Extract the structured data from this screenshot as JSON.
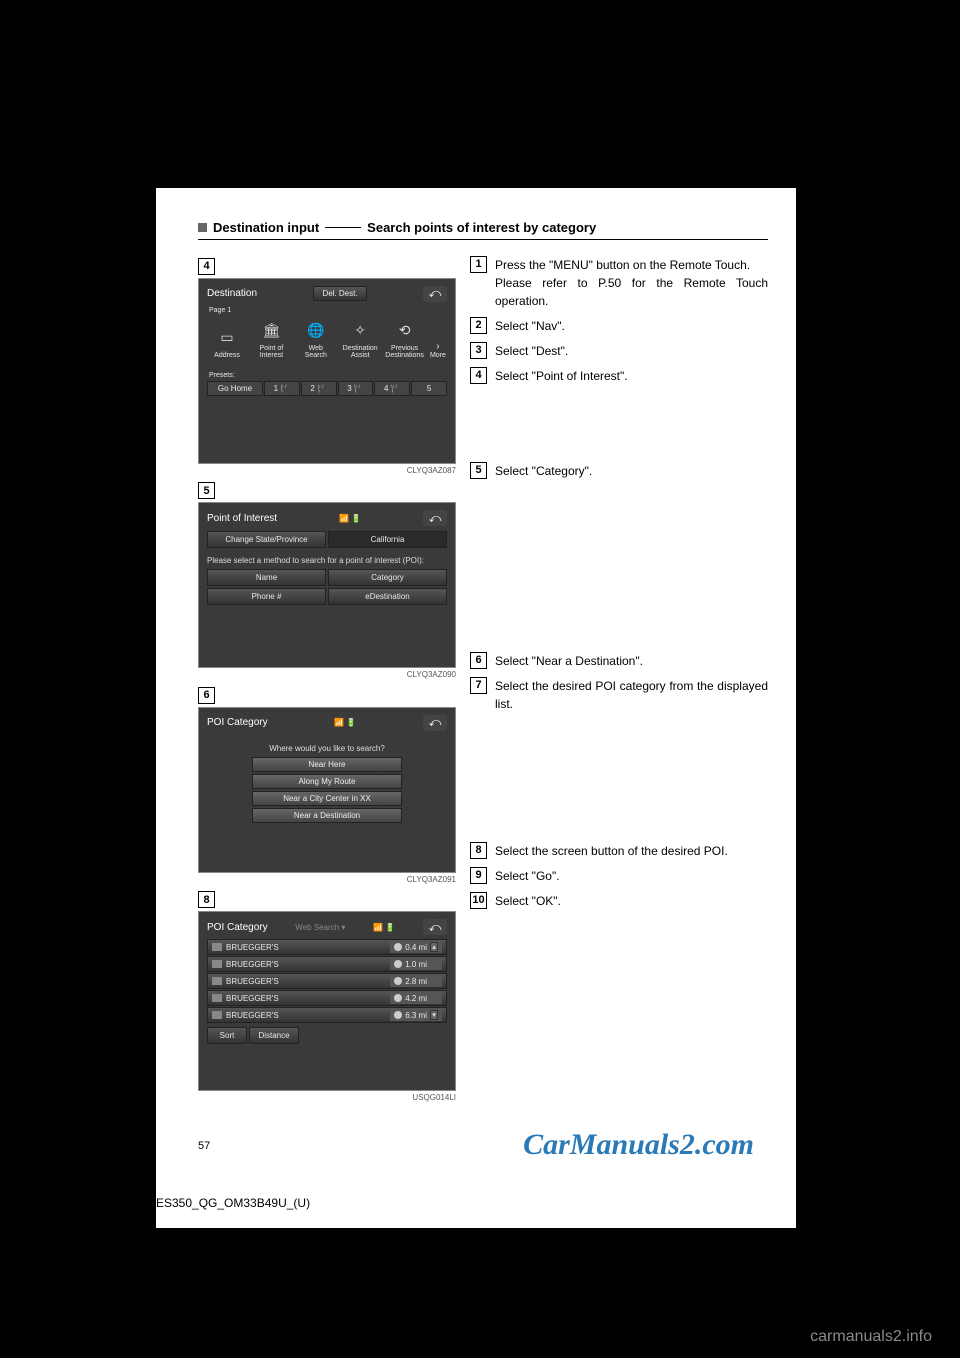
{
  "header": {
    "prefix": "Destination input",
    "title": "Search points of interest by category"
  },
  "screens": {
    "s4": {
      "badge": "4",
      "title": "Destination",
      "del": "Del. Dest.",
      "page": "Page 1",
      "icons": [
        "Address",
        "Point of\nInterest",
        "Web\nSearch",
        "Destination\nAssist",
        "Previous\nDestinations",
        "More"
      ],
      "presets_label": "Presets:",
      "presets": [
        "Go Home",
        "1",
        "2",
        "3",
        "4",
        "5"
      ],
      "ref": "CLYQ3AZ087"
    },
    "s5": {
      "badge": "5",
      "title": "Point of Interest",
      "state_btn": "Change State/Province",
      "state_val": "California",
      "msg": "Please select a method to search for a point of interest (POI):",
      "opts": [
        "Name",
        "Category",
        "Phone #",
        "eDestination"
      ],
      "ref": "CLYQ3AZ090"
    },
    "s6": {
      "badge": "6",
      "title": "POI Category",
      "msg": "Where would you like to search?",
      "opts": [
        "Near Here",
        "Along My Route",
        "Near a City Center in XX",
        "Near a Destination"
      ],
      "ref": "CLYQ3AZ091"
    },
    "s8": {
      "badge": "8",
      "title": "POI Category",
      "tab": "Web Search",
      "rows": [
        {
          "name": "BRUEGGER'S",
          "dist": "0.4 mi"
        },
        {
          "name": "BRUEGGER'S",
          "dist": "1.0 mi"
        },
        {
          "name": "BRUEGGER'S",
          "dist": "2.8 mi"
        },
        {
          "name": "BRUEGGER'S",
          "dist": "4.2 mi"
        },
        {
          "name": "BRUEGGER'S",
          "dist": "6.3 mi"
        }
      ],
      "sort": "Sort",
      "distance": "Distance",
      "ref": "USQG014LI"
    }
  },
  "steps": {
    "g1": [
      {
        "n": "1",
        "t": "Press the \"MENU\" button on the Remote Touch.",
        "sub": "Please refer to P.50 for the Remote Touch operation."
      },
      {
        "n": "2",
        "t": "Select \"Nav\"."
      },
      {
        "n": "3",
        "t": "Select \"Dest\"."
      },
      {
        "n": "4",
        "t": "Select \"Point of Interest\"."
      }
    ],
    "g2": [
      {
        "n": "5",
        "t": "Select \"Category\"."
      }
    ],
    "g3": [
      {
        "n": "6",
        "t": "Select \"Near a Destination\"."
      },
      {
        "n": "7",
        "t": "Select the desired POI category from the displayed list."
      }
    ],
    "g4": [
      {
        "n": "8",
        "t": "Select the screen button of the desired POI."
      },
      {
        "n": "9",
        "t": "Select \"Go\"."
      },
      {
        "n": "10",
        "t": "Select \"OK\"."
      }
    ]
  },
  "page_number": "57",
  "doc_ref": "ES350_QG_OM33B49U_(U)",
  "logo": "CarManuals2.com",
  "footer_brand": "carmanuals2.info"
}
